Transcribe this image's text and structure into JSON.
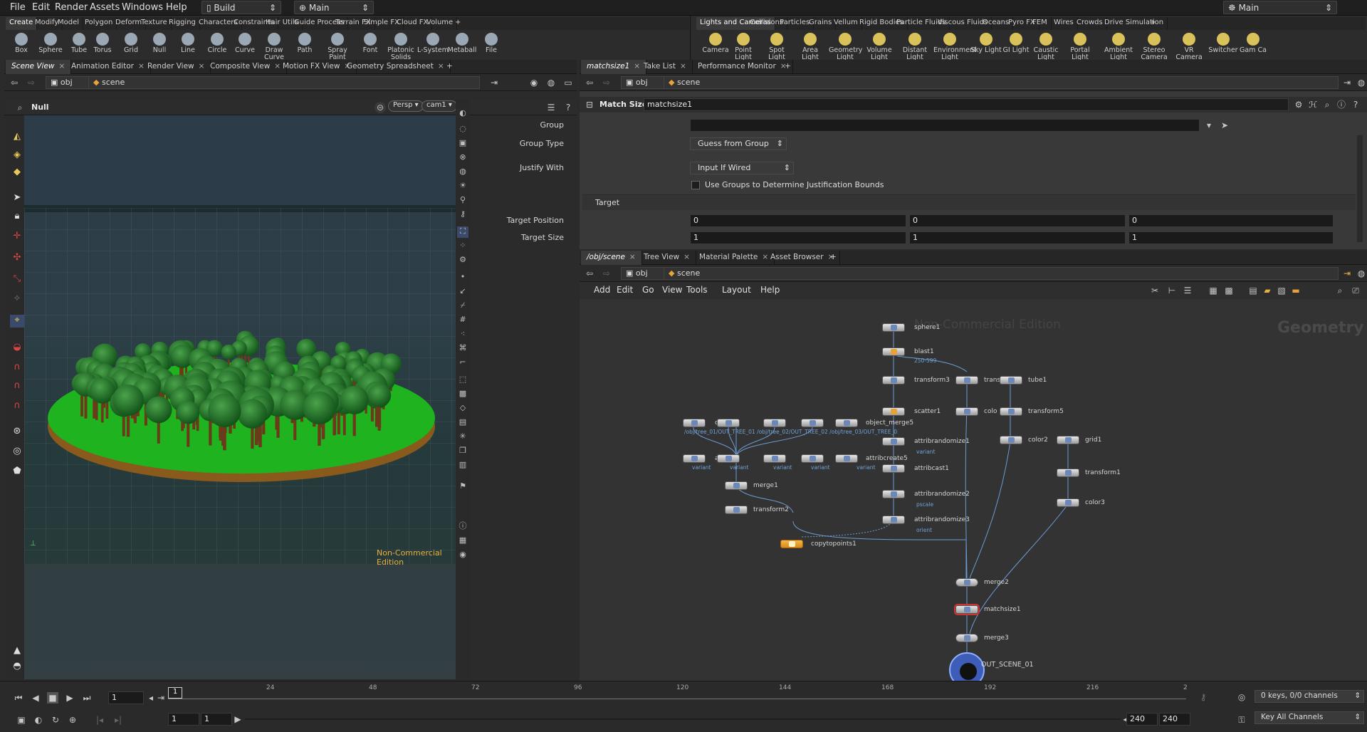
{
  "menubar": {
    "items": [
      "File",
      "Edit",
      "Render",
      "Assets",
      "Windows",
      "Help"
    ],
    "desktop": "Build",
    "context": "Main",
    "right_context": "Main"
  },
  "shelf_left": {
    "tabs": [
      "Create",
      "Modify",
      "Model",
      "Polygon",
      "Deform",
      "Texture",
      "Rigging",
      "Characters",
      "Constraints",
      "Hair Utils",
      "Guide Process",
      "Terrain FX",
      "Simple FX",
      "Cloud FX",
      "Volume"
    ],
    "tools": [
      "Box",
      "Sphere",
      "Tube",
      "Torus",
      "Grid",
      "Null",
      "Line",
      "Circle",
      "Curve",
      "Draw Curve",
      "Path",
      "Spray Paint",
      "Font",
      "Platonic Solids",
      "L-System",
      "Metaball",
      "File"
    ]
  },
  "shelf_right": {
    "tabs": [
      "Lights and Cameras",
      "Collisions",
      "Particles",
      "Grains",
      "Vellum",
      "Rigid Bodies",
      "Particle Fluids",
      "Viscous Fluids",
      "Oceans",
      "Pyro FX",
      "FEM",
      "Wires",
      "Crowds",
      "Drive Simulation"
    ],
    "tools": [
      "Camera",
      "Point Light",
      "Spot Light",
      "Area Light",
      "Geometry Light",
      "Volume Light",
      "Distant Light",
      "Environment Light",
      "Sky Light",
      "GI Light",
      "Caustic Light",
      "Portal Light",
      "Ambient Light",
      "Stereo Camera",
      "VR Camera",
      "Switcher",
      "Gam Ca"
    ]
  },
  "left_pane": {
    "tabs": [
      "Scene View",
      "Animation Editor",
      "Render View",
      "Composite View",
      "Motion FX View",
      "Geometry Spreadsheet"
    ],
    "path_obj": "obj",
    "path_scene": "scene",
    "op_name": "Null",
    "persp": "Persp",
    "cam": "cam1",
    "watermark": "Non-Commercial Edition"
  },
  "param_pane": {
    "tabs": [
      "matchsize1",
      "Take List",
      "Performance Monitor"
    ],
    "path_obj": "obj",
    "path_scene": "scene",
    "node_type": "Match Size",
    "node_name": "matchsize1",
    "group_label": "Group",
    "group_value": "",
    "group_type_label": "Group Type",
    "group_type_value": "Guess from Group",
    "justify_label": "Justify With",
    "justify_value": "Input If Wired",
    "use_groups_label": "Use Groups to Determine Justification Bounds",
    "target_section": "Target",
    "target_position_label": "Target Position",
    "target_position": [
      "0",
      "0",
      "0"
    ],
    "target_size_label": "Target Size",
    "target_size": [
      "1",
      "1",
      "1"
    ]
  },
  "network_pane": {
    "tabs": [
      "/obj/scene",
      "Tree View",
      "Material Palette",
      "Asset Browser"
    ],
    "path_obj": "obj",
    "path_scene": "scene",
    "menu": [
      "Add",
      "Edit",
      "Go",
      "View",
      "Tools",
      "Layout",
      "Help"
    ],
    "watermark": "Non-Commercial Edition",
    "context_label": "Geometry",
    "nodes": {
      "sphere1": "sphere1",
      "blast1": "blast1",
      "blast1_sub": "250-599",
      "transform3": "transform3",
      "transform4": "trans",
      "tube1": "tube1",
      "scatter1": "scatter1",
      "color1": "colo",
      "transform5": "transform5",
      "attribrandomize1": "attribrandomize1",
      "attribrandomize1_sub": "variant",
      "color2": "color2",
      "grid1": "grid1",
      "attribcast1": "attribcast1",
      "transform1": "transform1",
      "attribrandomize2": "attribrandomize2",
      "attribrandomize2_sub": "pscale",
      "color3": "color3",
      "attribrandomize3": "attribrandomize3",
      "attribrandomize3_sub": "orient",
      "object_merge1": "obj",
      "object_merge5": "object_merge5",
      "object_merge_paths": "/obj/tree_01/OUT_TREE_01  /obj/tree_02/OUT_TREE_02  /obj/tree_03/OUT_TREE_03  /obj/tree_04/OUT_TREE_04  /obj/tree_05/OUT_TREE_05",
      "attribcreate1": "attri",
      "attribcreate5": "attribcreate5",
      "variant": "variant",
      "merge1": "merge1",
      "transform2": "transform2",
      "copytopoints1": "copytopoints1",
      "merge2": "merge2",
      "matchsize1": "matchsize1",
      "merge3": "merge3",
      "out_scene": "OUT_SCENE_01"
    }
  },
  "timeline": {
    "frame": "1",
    "ticks": [
      "24",
      "48",
      "72",
      "96",
      "120",
      "144",
      "168",
      "192",
      "216",
      "2"
    ],
    "start1": "1",
    "start2": "1",
    "end1": "240",
    "end2": "240",
    "keys_status": "0 keys, 0/0 channels",
    "key_all": "Key All Channels"
  },
  "colors": {
    "accent_orange": "#e8a23a",
    "ground_green": "#1fb31f",
    "wire_blue": "#6d9bd6"
  }
}
